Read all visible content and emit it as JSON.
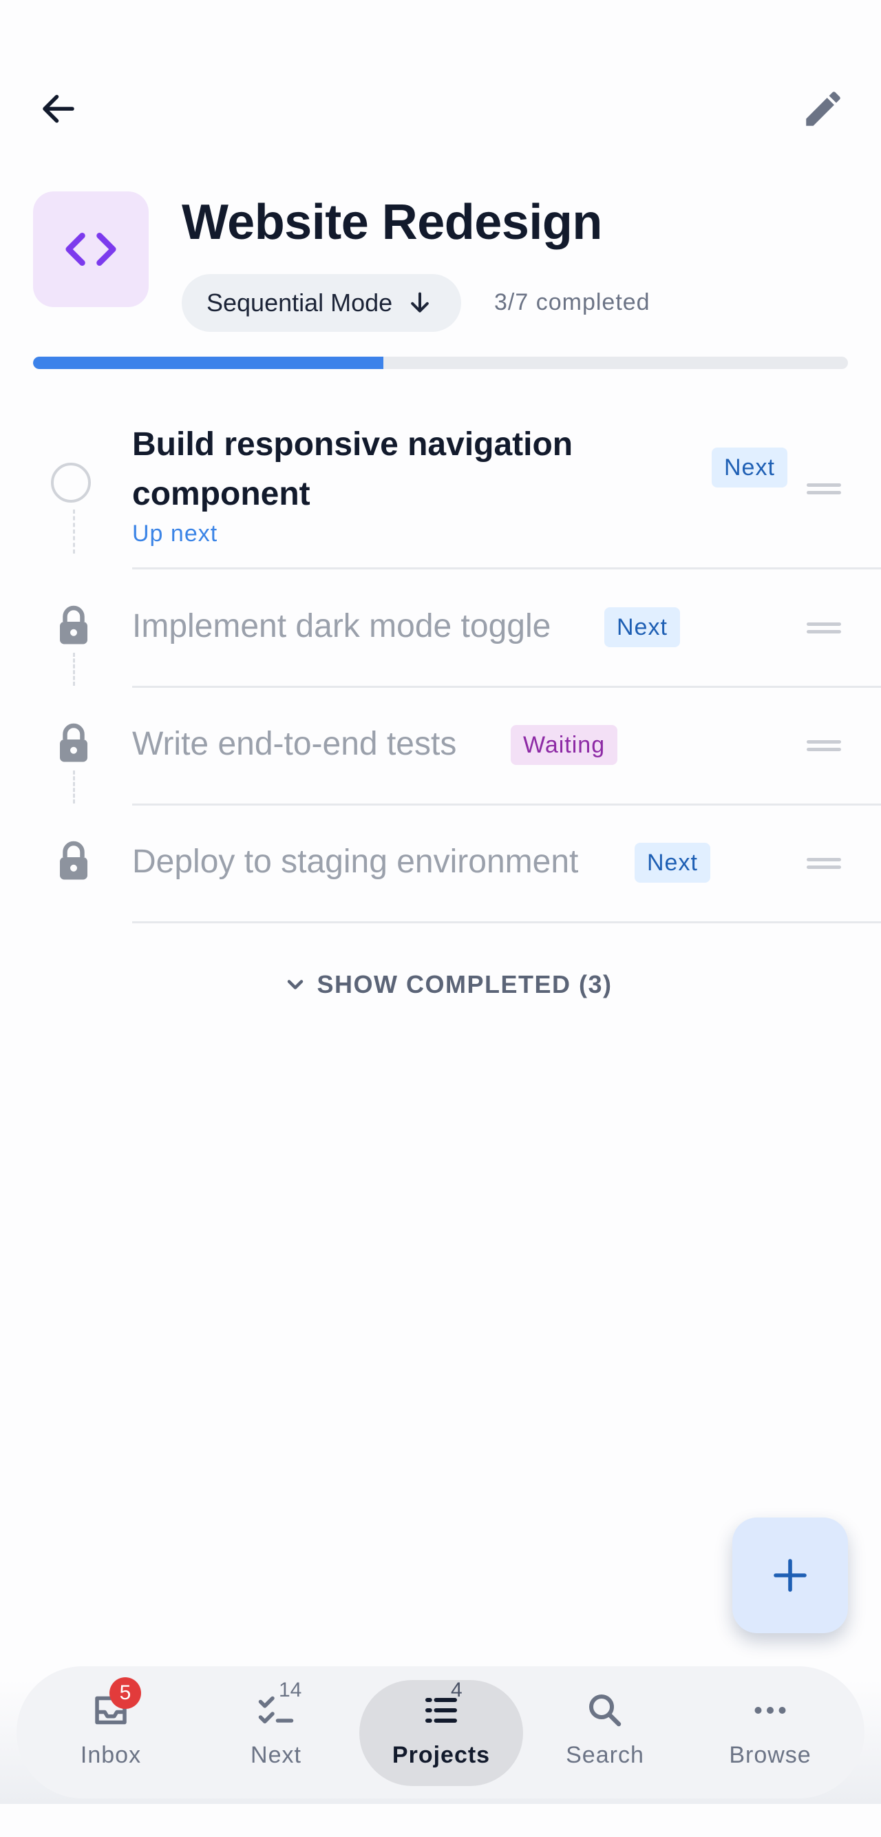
{
  "header": {
    "title": "Website Redesign",
    "mode_label": "Sequential Mode",
    "progress_text": "3/7 completed",
    "progress": 0.43,
    "back_icon": "arrow-left-icon",
    "edit_icon": "pencil-icon",
    "project_icon": "code-icon"
  },
  "tasks": [
    {
      "title_line1": "Build responsive navigation",
      "title_line2": "component",
      "subtitle": "Up next",
      "badge": "Next",
      "state": "available"
    },
    {
      "title": "Implement dark mode toggle",
      "badge": "Next",
      "state": "locked"
    },
    {
      "title": "Write end-to-end tests",
      "badge": "Waiting",
      "state": "locked"
    },
    {
      "title": "Deploy to staging environment",
      "badge": "Next",
      "state": "locked"
    }
  ],
  "show_completed": "SHOW COMPLETED (3)",
  "nav": {
    "items": [
      {
        "label": "Inbox",
        "badge": "5",
        "icon": "inbox-icon"
      },
      {
        "label": "Next",
        "count": "14",
        "icon": "checklist-icon"
      },
      {
        "label": "Projects",
        "count": "4",
        "icon": "list-icon",
        "active": true
      },
      {
        "label": "Search",
        "icon": "search-icon"
      },
      {
        "label": "Browse",
        "icon": "more-icon"
      }
    ]
  },
  "colors": {
    "accent": "#3c82ea",
    "title": "#121a2c",
    "badge_next_bg": "#e1efff",
    "badge_next_text": "#1e5fb4",
    "badge_waiting_bg": "#f3e0f6",
    "badge_waiting_text": "#8d2aa5",
    "project_icon_bg": "#f1e5fb",
    "project_icon_fg": "#7c3aed",
    "locked_text": "#9aa0ab"
  }
}
